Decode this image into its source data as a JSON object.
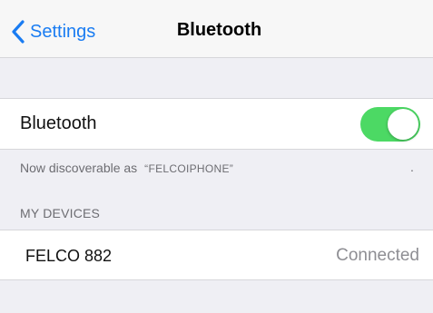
{
  "nav": {
    "back_label": "Settings",
    "title": "Bluetooth"
  },
  "bluetooth": {
    "label": "Bluetooth",
    "enabled": true,
    "toggle_color": "#4cd964"
  },
  "discoverable": {
    "prefix": "Now discoverable as",
    "device_name": "“FELCOIPHONE”",
    "trailing": "."
  },
  "my_devices": {
    "header": "MY DEVICES",
    "items": [
      {
        "name": "FELCO 882",
        "status": "Connected"
      }
    ]
  },
  "colors": {
    "accent": "#1a7cf2",
    "background": "#efeff4",
    "secondary_text": "#6d6d72"
  },
  "icons": {
    "back": "chevron-left-icon"
  }
}
